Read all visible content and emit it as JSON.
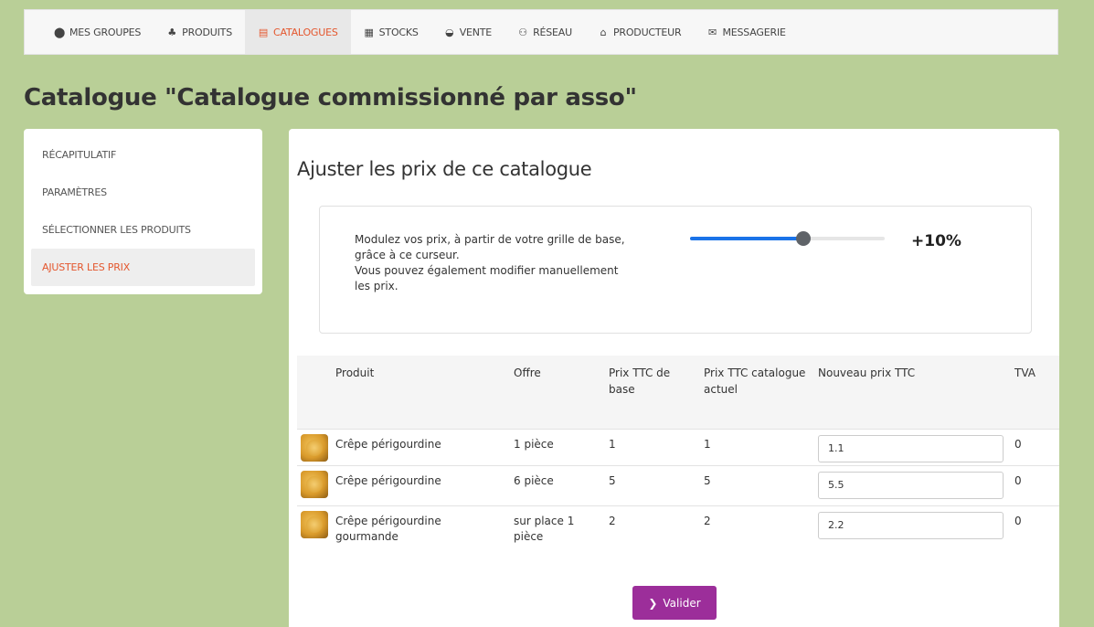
{
  "nav": [
    {
      "icon": "map-pin-icon",
      "glyph": "⬤",
      "label": "MES GROUPES"
    },
    {
      "icon": "products-icon",
      "glyph": "♣",
      "label": "PRODUITS"
    },
    {
      "icon": "catalog-icon",
      "glyph": "▤",
      "label": "CATALOGUES",
      "active": true
    },
    {
      "icon": "stocks-icon",
      "glyph": "▦",
      "label": "STOCKS"
    },
    {
      "icon": "sale-icon",
      "glyph": "◒",
      "label": "VENTE"
    },
    {
      "icon": "network-icon",
      "glyph": "⚇",
      "label": "RÉSEAU"
    },
    {
      "icon": "producer-icon",
      "glyph": "⌂",
      "label": "PRODUCTEUR"
    },
    {
      "icon": "envelope-icon",
      "glyph": "✉",
      "label": "MESSAGERIE"
    }
  ],
  "page_title": "Catalogue \"Catalogue commissionné par asso\"",
  "sidebar": {
    "items": [
      {
        "label": "RÉCAPITULATIF"
      },
      {
        "label": "PARAMÈTRES"
      },
      {
        "label": "SÉLECTIONNER LES PRODUITS"
      },
      {
        "label": "AJUSTER LES PRIX",
        "active": true
      }
    ]
  },
  "main": {
    "title": "Ajuster les prix de ce catalogue",
    "slider": {
      "description_lines": [
        "Modulez vos prix, à partir de votre grille de base,",
        "grâce à ce curseur.",
        "Vous pouvez également modifier manuellement",
        "les prix."
      ],
      "value_label": "+10%",
      "fill_fraction": 0.58,
      "accent_color": "#1a73e8"
    },
    "table": {
      "headers": {
        "product": "Produit",
        "offer": "Offre",
        "base_price": "Prix TTC de base",
        "current_price": "Prix TTC catalogue actuel",
        "new_price": "Nouveau prix TTC",
        "vat": "TVA"
      },
      "rows": [
        {
          "product": "Crêpe périgourdine",
          "offer": "1 pièce",
          "base": "1",
          "current": "1",
          "new_price": "1.1",
          "vat": "0"
        },
        {
          "product": "Crêpe périgourdine",
          "offer": "6 pièce",
          "base": "5",
          "current": "5",
          "new_price": "5.5",
          "vat": "0"
        },
        {
          "product": "Crêpe périgourdine gourmande",
          "offer": "sur place 1 pièce",
          "base": "2",
          "current": "2",
          "new_price": "2.2",
          "vat": "0"
        }
      ]
    },
    "submit": {
      "icon": "chevron-right-icon",
      "glyph": "❯",
      "label": "Valider",
      "color": "#9c2e9a"
    }
  }
}
